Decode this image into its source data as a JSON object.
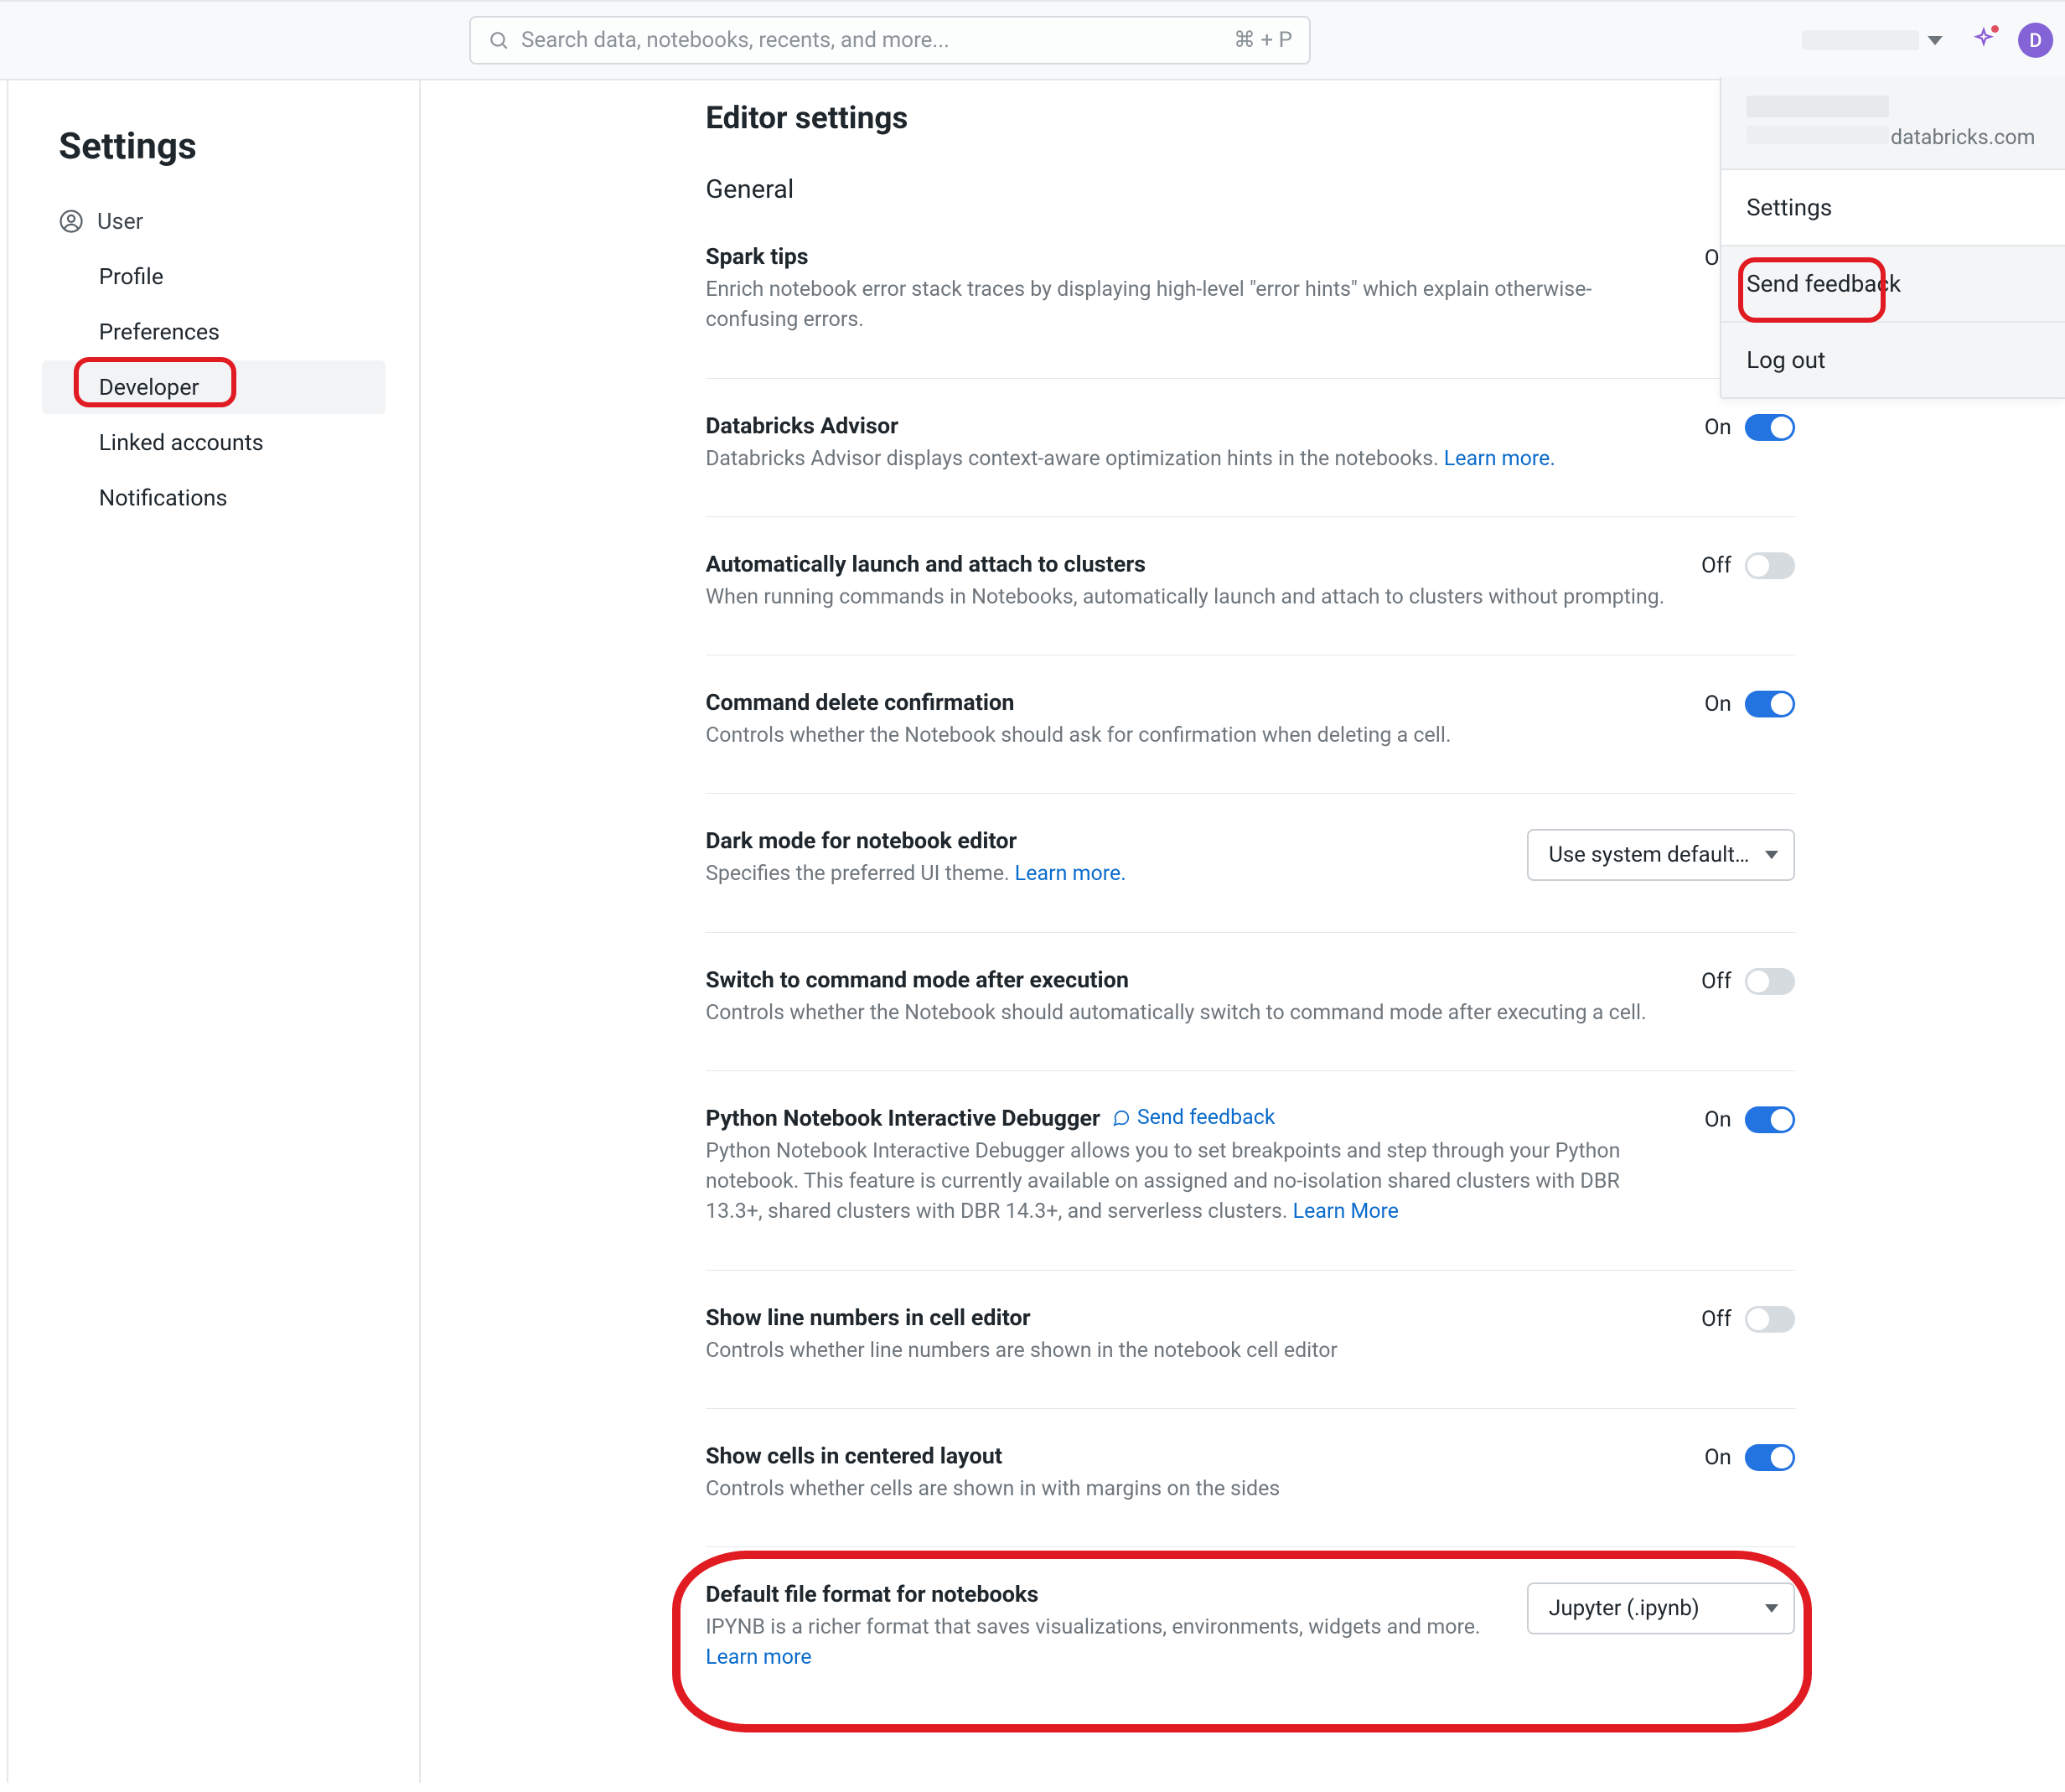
{
  "search": {
    "placeholder": "Search data, notebooks, recents, and more...",
    "shortcut": "⌘ + P"
  },
  "avatar_initial": "D",
  "user_menu": {
    "email_suffix": "databricks.com",
    "items": [
      "Settings",
      "Send feedback",
      "Log out"
    ]
  },
  "sidebar": {
    "title": "Settings",
    "section": "User",
    "items": [
      "Profile",
      "Preferences",
      "Developer",
      "Linked accounts",
      "Notifications"
    ],
    "active_index": 2
  },
  "page": {
    "title": "Editor settings",
    "section": "General"
  },
  "settings": [
    {
      "key": "spark_tips",
      "title": "Spark tips",
      "desc": "Enrich notebook error stack traces by displaying high-level \"error hints\" which explain otherwise-confusing errors.",
      "control": "toggle",
      "state": "On"
    },
    {
      "key": "advisor",
      "title": "Databricks Advisor",
      "desc": "Databricks Advisor displays context-aware optimization hints in the notebooks. ",
      "link": "Learn more.",
      "control": "toggle",
      "state": "On"
    },
    {
      "key": "auto_launch",
      "title": "Automatically launch and attach to clusters",
      "desc": "When running commands in Notebooks, automatically launch and attach to clusters without prompting.",
      "control": "toggle",
      "state": "Off"
    },
    {
      "key": "delete_confirm",
      "title": "Command delete confirmation",
      "desc": "Controls whether the Notebook should ask for confirmation when deleting a cell.",
      "control": "toggle",
      "state": "On"
    },
    {
      "key": "dark_mode",
      "title": "Dark mode for notebook editor",
      "desc": "Specifies the preferred UI theme. ",
      "link": "Learn more.",
      "control": "select",
      "value": "Use system default…"
    },
    {
      "key": "command_mode",
      "title": "Switch to command mode after execution",
      "desc": "Controls whether the Notebook should automatically switch to command mode after executing a cell.",
      "control": "toggle",
      "state": "Off"
    },
    {
      "key": "debugger",
      "title": "Python Notebook Interactive Debugger",
      "feedback": "Send feedback",
      "desc": "Python Notebook Interactive Debugger allows you to set breakpoints and step through your Python notebook. This feature is currently available on assigned and no-isolation shared clusters with DBR 13.3+, shared clusters with DBR 14.3+, and serverless clusters. ",
      "link": "Learn More",
      "control": "toggle",
      "state": "On"
    },
    {
      "key": "line_numbers",
      "title": "Show line numbers in cell editor",
      "desc": "Controls whether line numbers are shown in the notebook cell editor",
      "control": "toggle",
      "state": "Off"
    },
    {
      "key": "centered",
      "title": "Show cells in centered layout",
      "desc": "Controls whether cells are shown in with margins on the sides",
      "control": "toggle",
      "state": "On"
    },
    {
      "key": "file_format",
      "title": "Default file format for notebooks",
      "desc": "IPYNB is a richer format that saves visualizations, environments, widgets and more. ",
      "link": "Learn more",
      "control": "select",
      "value": "Jupyter (.ipynb)"
    }
  ]
}
